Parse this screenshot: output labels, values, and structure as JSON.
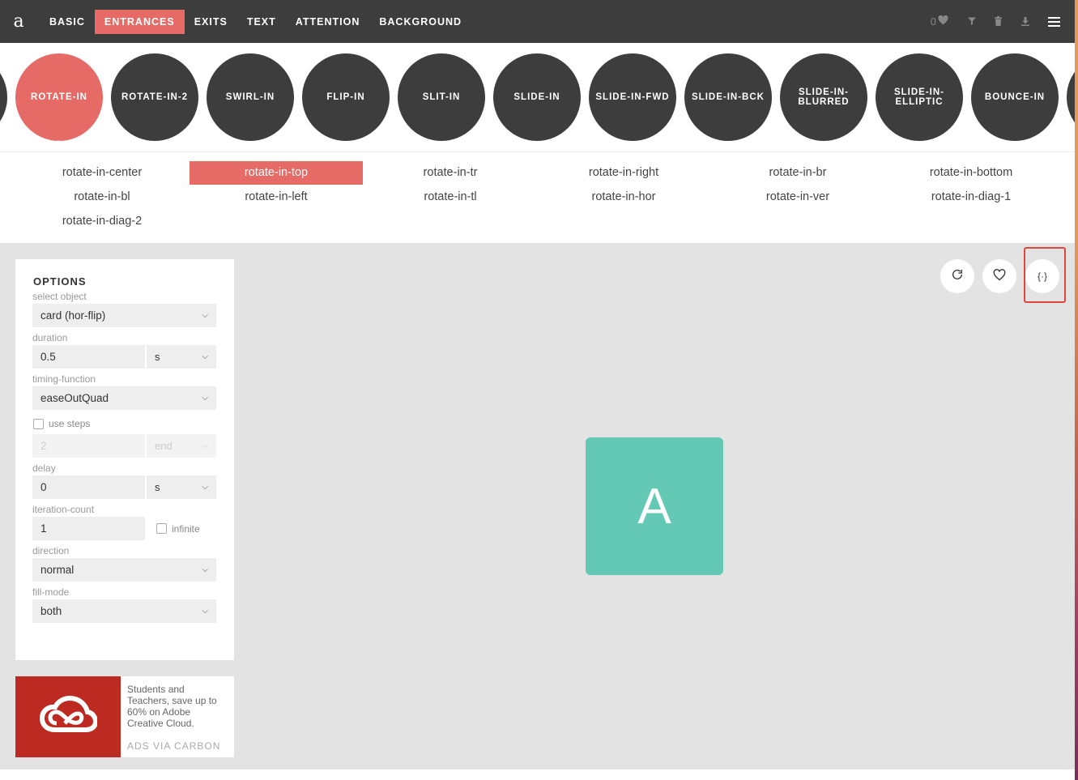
{
  "topbar": {
    "logo": "a",
    "nav": [
      "BASIC",
      "ENTRANCES",
      "EXITS",
      "TEXT",
      "ATTENTION",
      "BACKGROUND"
    ],
    "active_nav": "ENTRANCES",
    "favorites_count": "0",
    "icons": [
      "heart-icon",
      "filter-icon",
      "trash-icon",
      "download-icon",
      "menu-icon"
    ]
  },
  "animations": [
    "ROTATE-IN",
    "ROTATE-IN-2",
    "SWIRL-IN",
    "FLIP-IN",
    "SLIT-IN",
    "SLIDE-IN",
    "SLIDE-IN-FWD",
    "SLIDE-IN-BCK",
    "SLIDE-IN-BLURRED",
    "SLIDE-IN-ELLIPTIC",
    "BOUNCE-IN"
  ],
  "active_animation": "ROTATE-IN",
  "variants": [
    "rotate-in-center",
    "rotate-in-top",
    "rotate-in-tr",
    "rotate-in-right",
    "rotate-in-br",
    "rotate-in-bottom",
    "rotate-in-bl",
    "rotate-in-left",
    "rotate-in-tl",
    "rotate-in-hor",
    "rotate-in-ver",
    "rotate-in-diag-1",
    "rotate-in-diag-2"
  ],
  "active_variant": "rotate-in-top",
  "options": {
    "title": "OPTIONS",
    "select_object_label": "select object",
    "select_object_value": "card (hor-flip)",
    "duration_label": "duration",
    "duration_value": "0.5",
    "duration_unit": "s",
    "timing_label": "timing-function",
    "timing_value": "easeOutQuad",
    "use_steps_label": "use steps",
    "steps_value": "2",
    "steps_position": "end",
    "delay_label": "delay",
    "delay_value": "0",
    "delay_unit": "s",
    "iteration_label": "iteration-count",
    "iteration_value": "1",
    "infinite_label": "infinite",
    "direction_label": "direction",
    "direction_value": "normal",
    "fill_mode_label": "fill-mode",
    "fill_mode_value": "both"
  },
  "ad": {
    "copy": "Students and Teachers, save up to 60% on Adobe Creative Cloud.",
    "via": "ADS VIA CARBON"
  },
  "stage": {
    "card_letter": "A",
    "code_button_label": "{·}"
  },
  "colors": {
    "accent": "#e66a66",
    "dark": "#3d3d3d",
    "card": "#64c9b4",
    "highlight": "#e0463c"
  }
}
